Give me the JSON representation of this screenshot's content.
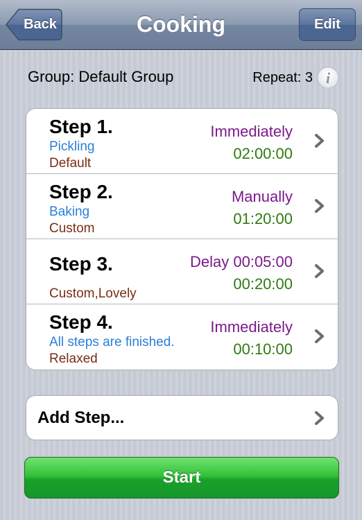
{
  "navbar": {
    "title": "Cooking",
    "back_label": "Back",
    "edit_label": "Edit"
  },
  "summary": {
    "group": "Group: Default Group",
    "repeat": "Repeat: 3",
    "info_icon": "info-icon"
  },
  "steps": [
    {
      "title": "Step 1.",
      "name": "Pickling",
      "tag": "Default",
      "trigger": "Immediately",
      "time": "02:00:00"
    },
    {
      "title": "Step 2.",
      "name": "Baking",
      "tag": "Custom",
      "trigger": "Manually",
      "time": "01:20:00"
    },
    {
      "title": "Step 3.",
      "name": "",
      "tag": "Custom,Lovely",
      "trigger": "Delay 00:05:00",
      "time": "00:20:00"
    },
    {
      "title": "Step 4.",
      "name": "All steps are finished.",
      "tag": "Relaxed",
      "trigger": "Immediately",
      "time": "00:10:00"
    }
  ],
  "add_step_label": "Add Step...",
  "start_label": "Start",
  "colors": {
    "name": "#2a7fd8",
    "tag": "#7a2c13",
    "trigger": "#7b1a8c",
    "time": "#2f7a11",
    "start": "#2ab034"
  }
}
